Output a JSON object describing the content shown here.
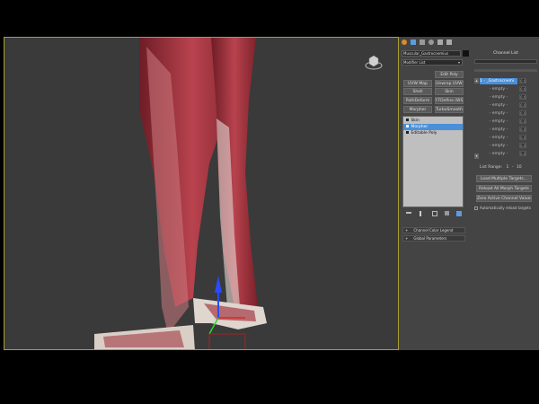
{
  "modifier_panel": {
    "object_name": "Muscular_Gastrocnemius",
    "modifier_list_label": "Modifier List",
    "buttons": [
      "Edit Poly",
      "UVW Map",
      "Unwrap UVW",
      "Shell",
      "Skin",
      "PathDeform",
      "FFDefine (WS)",
      "Morpher",
      "TurboSmooth"
    ],
    "stack": [
      {
        "label": "Skin",
        "selected": false
      },
      {
        "label": "Morpher",
        "selected": true
      },
      {
        "label": "Editable Poly",
        "selected": false
      }
    ]
  },
  "channel_panel": {
    "header": "Channel List",
    "channel_1": "1 - _Gastrocnemi",
    "empty_label": "- empty -",
    "value_label": "0.0",
    "list_range": "List Range:",
    "range_from": "1",
    "range_to": "10",
    "buttons": [
      "Load Multiple Targets...",
      "Reload All Morph Targets",
      "Zero Active Channel Values"
    ],
    "checkbox_label": "Automatically reload targets"
  },
  "rollouts": [
    "Channel Color Legend",
    "Global Parameters"
  ],
  "colors": {
    "accent": "#4a8fd8",
    "viewport_bg": "#3a3a3a",
    "muscle": "#a83a45",
    "viewport_border": "#a8a030"
  }
}
